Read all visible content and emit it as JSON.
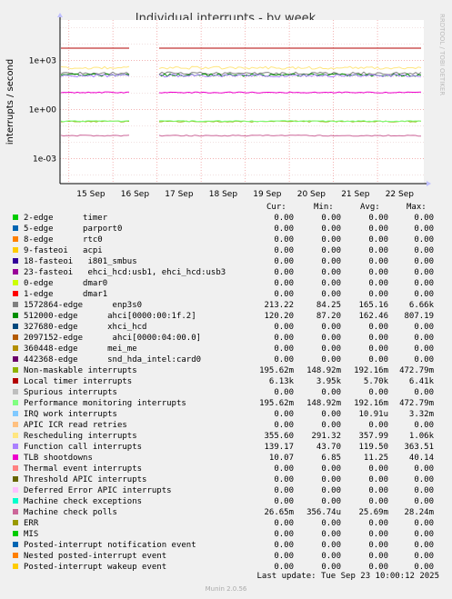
{
  "watermark": "RRDTOOL / TOBI OETIKER",
  "footer": {
    "last_update": "Last update: Tue Sep 23 10:00:12 2025",
    "version": "Munin 2.0.56"
  },
  "columns": {
    "cur": "Cur:",
    "min": "Min:",
    "avg": "Avg:",
    "max": "Max:"
  },
  "chart_data": {
    "type": "line",
    "title": "Individual interrupts - by week",
    "ylabel": "interrupts / second",
    "yscale": "log",
    "ylim": [
      3e-05,
      300000
    ],
    "y_ticks": [
      "1e+03",
      "1e+00",
      "1e-03"
    ],
    "x_ticks": [
      "15 Sep",
      "16 Sep",
      "17 Sep",
      "18 Sep",
      "19 Sep",
      "20 Sep",
      "21 Sep",
      "22 Sep"
    ],
    "series": [
      {
        "name": "2-edge      timer",
        "color": "#00cc00",
        "cur": "0.00",
        "min": "0.00",
        "avg": "0.00",
        "max": "0.00",
        "level": 0
      },
      {
        "name": "5-edge      parport0",
        "color": "#0066b3",
        "cur": "0.00",
        "min": "0.00",
        "avg": "0.00",
        "max": "0.00",
        "level": 0
      },
      {
        "name": "8-edge      rtc0",
        "color": "#ff8000",
        "cur": "0.00",
        "min": "0.00",
        "avg": "0.00",
        "max": "0.00",
        "level": 0
      },
      {
        "name": "9-fasteoi   acpi",
        "color": "#ffcc00",
        "cur": "0.00",
        "min": "0.00",
        "avg": "0.00",
        "max": "0.00",
        "level": 0
      },
      {
        "name": "18-fasteoi   i801_smbus",
        "color": "#330099",
        "cur": "0.00",
        "min": "0.00",
        "avg": "0.00",
        "max": "0.00",
        "level": 0
      },
      {
        "name": "23-fasteoi   ehci_hcd:usb1, ehci_hcd:usb3",
        "color": "#990099",
        "cur": "0.00",
        "min": "0.00",
        "avg": "0.00",
        "max": "0.00",
        "level": 0
      },
      {
        "name": "0-edge      dmar0",
        "color": "#ccff00",
        "cur": "0.00",
        "min": "0.00",
        "avg": "0.00",
        "max": "0.00",
        "level": 0
      },
      {
        "name": "1-edge      dmar1",
        "color": "#ff0000",
        "cur": "0.00",
        "min": "0.00",
        "avg": "0.00",
        "max": "0.00",
        "level": 0
      },
      {
        "name": "1572864-edge      enp3s0",
        "color": "#808080",
        "cur": "213.22",
        "min": "84.25",
        "avg": "165.16",
        "max": "6.66k",
        "level": 165
      },
      {
        "name": "512000-edge      ahci[0000:00:1f.2]",
        "color": "#008f00",
        "cur": "120.20",
        "min": "87.20",
        "avg": "162.46",
        "max": "807.19",
        "level": 130
      },
      {
        "name": "327680-edge      xhci_hcd",
        "color": "#00487d",
        "cur": "0.00",
        "min": "0.00",
        "avg": "0.00",
        "max": "0.00",
        "level": 0
      },
      {
        "name": "2097152-edge      ahci[0000:04:00.0]",
        "color": "#b35a00",
        "cur": "0.00",
        "min": "0.00",
        "avg": "0.00",
        "max": "0.00",
        "level": 0
      },
      {
        "name": "360448-edge      mei_me",
        "color": "#b38f00",
        "cur": "0.00",
        "min": "0.00",
        "avg": "0.00",
        "max": "0.00",
        "level": 0
      },
      {
        "name": "442368-edge      snd_hda_intel:card0",
        "color": "#6b006b",
        "cur": "0.00",
        "min": "0.00",
        "avg": "0.00",
        "max": "0.00",
        "level": 0
      },
      {
        "name": "Non-maskable interrupts",
        "color": "#8fb300",
        "cur": "195.62m",
        "min": "148.92m",
        "avg": "192.16m",
        "max": "472.79m",
        "level": 0.19
      },
      {
        "name": "Local timer interrupts",
        "color": "#b30000",
        "cur": "6.13k",
        "min": "3.95k",
        "avg": "5.70k",
        "max": "6.41k",
        "level": 5700
      },
      {
        "name": "Spurious interrupts",
        "color": "#bebebe",
        "cur": "0.00",
        "min": "0.00",
        "avg": "0.00",
        "max": "0.00",
        "level": 0
      },
      {
        "name": "Performance monitoring interrupts",
        "color": "#80ff80",
        "cur": "195.62m",
        "min": "148.92m",
        "avg": "192.16m",
        "max": "472.79m",
        "level": 0.2
      },
      {
        "name": "IRQ work interrupts",
        "color": "#80c9ff",
        "cur": "0.00",
        "min": "0.00",
        "avg": "10.91u",
        "max": "3.32m",
        "level": 0
      },
      {
        "name": "APIC ICR read retries",
        "color": "#ffc080",
        "cur": "0.00",
        "min": "0.00",
        "avg": "0.00",
        "max": "0.00",
        "level": 0
      },
      {
        "name": "Rescheduling interrupts",
        "color": "#ffe680",
        "cur": "355.60",
        "min": "291.32",
        "avg": "357.99",
        "max": "1.06k",
        "level": 358
      },
      {
        "name": "Function call interrupts",
        "color": "#aa80ff",
        "cur": "139.17",
        "min": "43.70",
        "avg": "119.50",
        "max": "363.51",
        "level": 119.5
      },
      {
        "name": "TLB shootdowns",
        "color": "#ee00cc",
        "cur": "10.07",
        "min": "6.85",
        "avg": "11.25",
        "max": "40.14",
        "level": 11.25
      },
      {
        "name": "Thermal event interrupts",
        "color": "#ff8080",
        "cur": "0.00",
        "min": "0.00",
        "avg": "0.00",
        "max": "0.00",
        "level": 0
      },
      {
        "name": "Threshold APIC interrupts",
        "color": "#666600",
        "cur": "0.00",
        "min": "0.00",
        "avg": "0.00",
        "max": "0.00",
        "level": 0
      },
      {
        "name": "Deferred Error APIC interrupts",
        "color": "#ffbfff",
        "cur": "0.00",
        "min": "0.00",
        "avg": "0.00",
        "max": "0.00",
        "level": 0
      },
      {
        "name": "Machine check exceptions",
        "color": "#00ffcc",
        "cur": "0.00",
        "min": "0.00",
        "avg": "0.00",
        "max": "0.00",
        "level": 0
      },
      {
        "name": "Machine check polls",
        "color": "#cc6699",
        "cur": "26.65m",
        "min": "356.74u",
        "avg": "25.69m",
        "max": "28.24m",
        "level": 0.0257
      },
      {
        "name": "ERR",
        "color": "#999900",
        "cur": "0.00",
        "min": "0.00",
        "avg": "0.00",
        "max": "0.00",
        "level": 0
      },
      {
        "name": "MIS",
        "color": "#00cc00",
        "cur": "0.00",
        "min": "0.00",
        "avg": "0.00",
        "max": "0.00",
        "level": 0
      },
      {
        "name": "Posted-interrupt notification event",
        "color": "#0066b3",
        "cur": "0.00",
        "min": "0.00",
        "avg": "0.00",
        "max": "0.00",
        "level": 0
      },
      {
        "name": "Nested posted-interrupt event",
        "color": "#ff8000",
        "cur": "0.00",
        "min": "0.00",
        "avg": "0.00",
        "max": "0.00",
        "level": 0
      },
      {
        "name": "Posted-interrupt wakeup event",
        "color": "#ffcc00",
        "cur": "0.00",
        "min": "0.00",
        "avg": "0.00",
        "max": "0.00",
        "level": 0
      }
    ]
  }
}
